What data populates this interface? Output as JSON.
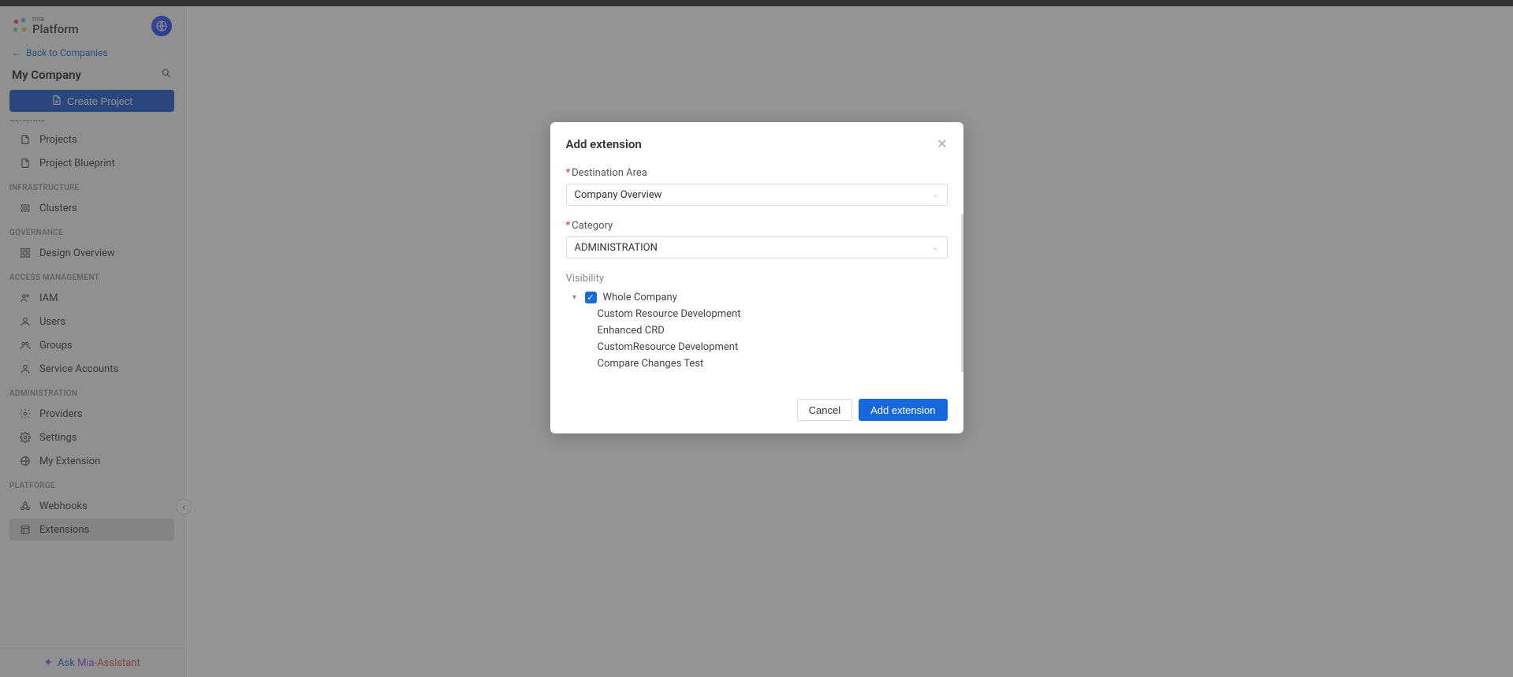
{
  "logo": {
    "mia": "mia",
    "platform": "Platform"
  },
  "back_link": "Back to Companies",
  "company_name": "My Company",
  "create_project": "Create Project",
  "sections": {
    "general": {
      "label": "GENERAL",
      "items": [
        "Projects",
        "Project Blueprint"
      ]
    },
    "infrastructure": {
      "label": "INFRASTRUCTURE",
      "items": [
        "Clusters"
      ]
    },
    "governance": {
      "label": "GOVERNANCE",
      "items": [
        "Design Overview"
      ]
    },
    "access": {
      "label": "ACCESS MANAGEMENT",
      "items": [
        "IAM",
        "Users",
        "Groups",
        "Service Accounts"
      ]
    },
    "administration": {
      "label": "ADMINISTRATION",
      "items": [
        "Providers",
        "Settings",
        "My Extension"
      ]
    },
    "platforge": {
      "label": "PLATFORGE",
      "items": [
        "Webhooks",
        "Extensions"
      ]
    }
  },
  "active_nav": "Extensions",
  "ask": {
    "ask": "Ask ",
    "mia": "Mia-",
    "assistant": "Assistant"
  },
  "modal": {
    "title": "Add extension",
    "fields": {
      "destination": {
        "label": "Destination Area",
        "value": "Company Overview"
      },
      "category": {
        "label": "Category",
        "value": "ADMINISTRATION"
      },
      "visibility": {
        "label": "Visibility",
        "root": "Whole Company",
        "children": [
          "Custom Resource Development",
          "Enhanced CRD",
          "CustomResource Development",
          "Compare Changes Test"
        ]
      }
    },
    "buttons": {
      "cancel": "Cancel",
      "confirm": "Add extension"
    }
  }
}
